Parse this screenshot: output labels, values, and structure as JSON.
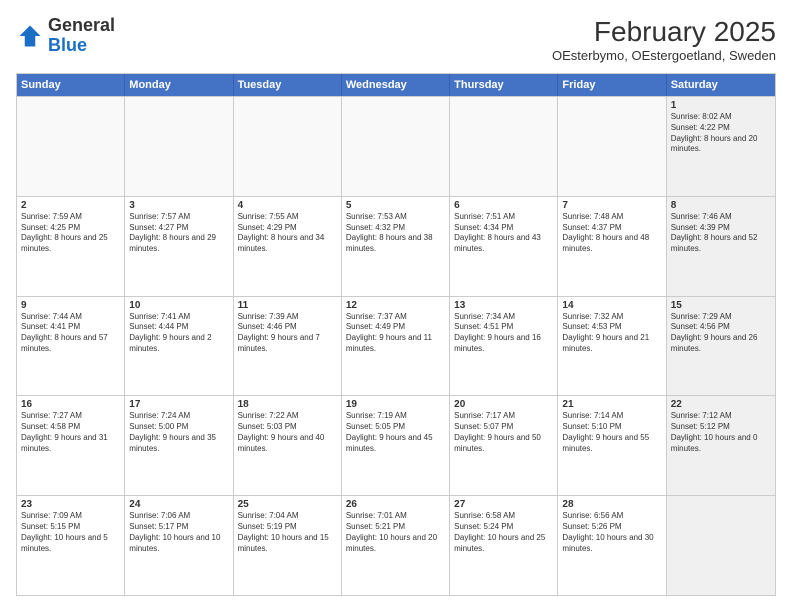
{
  "logo": {
    "general": "General",
    "blue": "Blue"
  },
  "header": {
    "month": "February 2025",
    "location": "OEsterbymo, OEstergoetland, Sweden"
  },
  "days": [
    "Sunday",
    "Monday",
    "Tuesday",
    "Wednesday",
    "Thursday",
    "Friday",
    "Saturday"
  ],
  "rows": [
    [
      {
        "day": "",
        "empty": true
      },
      {
        "day": "",
        "empty": true
      },
      {
        "day": "",
        "empty": true
      },
      {
        "day": "",
        "empty": true
      },
      {
        "day": "",
        "empty": true
      },
      {
        "day": "",
        "empty": true
      },
      {
        "day": "1",
        "sunrise": "Sunrise: 8:02 AM",
        "sunset": "Sunset: 4:22 PM",
        "daylight": "Daylight: 8 hours and 20 minutes.",
        "shaded": true
      }
    ],
    [
      {
        "day": "2",
        "sunrise": "Sunrise: 7:59 AM",
        "sunset": "Sunset: 4:25 PM",
        "daylight": "Daylight: 8 hours and 25 minutes."
      },
      {
        "day": "3",
        "sunrise": "Sunrise: 7:57 AM",
        "sunset": "Sunset: 4:27 PM",
        "daylight": "Daylight: 8 hours and 29 minutes."
      },
      {
        "day": "4",
        "sunrise": "Sunrise: 7:55 AM",
        "sunset": "Sunset: 4:29 PM",
        "daylight": "Daylight: 8 hours and 34 minutes."
      },
      {
        "day": "5",
        "sunrise": "Sunrise: 7:53 AM",
        "sunset": "Sunset: 4:32 PM",
        "daylight": "Daylight: 8 hours and 38 minutes."
      },
      {
        "day": "6",
        "sunrise": "Sunrise: 7:51 AM",
        "sunset": "Sunset: 4:34 PM",
        "daylight": "Daylight: 8 hours and 43 minutes."
      },
      {
        "day": "7",
        "sunrise": "Sunrise: 7:48 AM",
        "sunset": "Sunset: 4:37 PM",
        "daylight": "Daylight: 8 hours and 48 minutes."
      },
      {
        "day": "8",
        "sunrise": "Sunrise: 7:46 AM",
        "sunset": "Sunset: 4:39 PM",
        "daylight": "Daylight: 8 hours and 52 minutes.",
        "shaded": true
      }
    ],
    [
      {
        "day": "9",
        "sunrise": "Sunrise: 7:44 AM",
        "sunset": "Sunset: 4:41 PM",
        "daylight": "Daylight: 8 hours and 57 minutes."
      },
      {
        "day": "10",
        "sunrise": "Sunrise: 7:41 AM",
        "sunset": "Sunset: 4:44 PM",
        "daylight": "Daylight: 9 hours and 2 minutes."
      },
      {
        "day": "11",
        "sunrise": "Sunrise: 7:39 AM",
        "sunset": "Sunset: 4:46 PM",
        "daylight": "Daylight: 9 hours and 7 minutes."
      },
      {
        "day": "12",
        "sunrise": "Sunrise: 7:37 AM",
        "sunset": "Sunset: 4:49 PM",
        "daylight": "Daylight: 9 hours and 11 minutes."
      },
      {
        "day": "13",
        "sunrise": "Sunrise: 7:34 AM",
        "sunset": "Sunset: 4:51 PM",
        "daylight": "Daylight: 9 hours and 16 minutes."
      },
      {
        "day": "14",
        "sunrise": "Sunrise: 7:32 AM",
        "sunset": "Sunset: 4:53 PM",
        "daylight": "Daylight: 9 hours and 21 minutes."
      },
      {
        "day": "15",
        "sunrise": "Sunrise: 7:29 AM",
        "sunset": "Sunset: 4:56 PM",
        "daylight": "Daylight: 9 hours and 26 minutes.",
        "shaded": true
      }
    ],
    [
      {
        "day": "16",
        "sunrise": "Sunrise: 7:27 AM",
        "sunset": "Sunset: 4:58 PM",
        "daylight": "Daylight: 9 hours and 31 minutes."
      },
      {
        "day": "17",
        "sunrise": "Sunrise: 7:24 AM",
        "sunset": "Sunset: 5:00 PM",
        "daylight": "Daylight: 9 hours and 35 minutes."
      },
      {
        "day": "18",
        "sunrise": "Sunrise: 7:22 AM",
        "sunset": "Sunset: 5:03 PM",
        "daylight": "Daylight: 9 hours and 40 minutes."
      },
      {
        "day": "19",
        "sunrise": "Sunrise: 7:19 AM",
        "sunset": "Sunset: 5:05 PM",
        "daylight": "Daylight: 9 hours and 45 minutes."
      },
      {
        "day": "20",
        "sunrise": "Sunrise: 7:17 AM",
        "sunset": "Sunset: 5:07 PM",
        "daylight": "Daylight: 9 hours and 50 minutes."
      },
      {
        "day": "21",
        "sunrise": "Sunrise: 7:14 AM",
        "sunset": "Sunset: 5:10 PM",
        "daylight": "Daylight: 9 hours and 55 minutes."
      },
      {
        "day": "22",
        "sunrise": "Sunrise: 7:12 AM",
        "sunset": "Sunset: 5:12 PM",
        "daylight": "Daylight: 10 hours and 0 minutes.",
        "shaded": true
      }
    ],
    [
      {
        "day": "23",
        "sunrise": "Sunrise: 7:09 AM",
        "sunset": "Sunset: 5:15 PM",
        "daylight": "Daylight: 10 hours and 5 minutes."
      },
      {
        "day": "24",
        "sunrise": "Sunrise: 7:06 AM",
        "sunset": "Sunset: 5:17 PM",
        "daylight": "Daylight: 10 hours and 10 minutes."
      },
      {
        "day": "25",
        "sunrise": "Sunrise: 7:04 AM",
        "sunset": "Sunset: 5:19 PM",
        "daylight": "Daylight: 10 hours and 15 minutes."
      },
      {
        "day": "26",
        "sunrise": "Sunrise: 7:01 AM",
        "sunset": "Sunset: 5:21 PM",
        "daylight": "Daylight: 10 hours and 20 minutes."
      },
      {
        "day": "27",
        "sunrise": "Sunrise: 6:58 AM",
        "sunset": "Sunset: 5:24 PM",
        "daylight": "Daylight: 10 hours and 25 minutes."
      },
      {
        "day": "28",
        "sunrise": "Sunrise: 6:56 AM",
        "sunset": "Sunset: 5:26 PM",
        "daylight": "Daylight: 10 hours and 30 minutes."
      },
      {
        "day": "",
        "empty": true,
        "shaded": true
      }
    ]
  ]
}
